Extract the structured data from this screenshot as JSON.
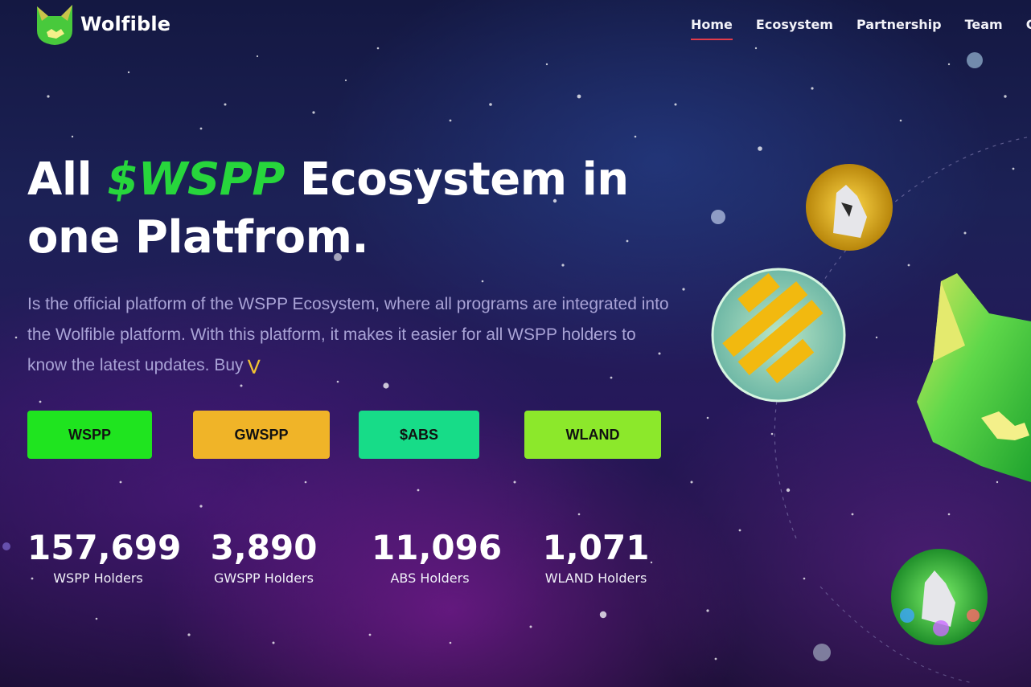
{
  "brand": {
    "name": "Wolfible"
  },
  "nav": {
    "items": [
      {
        "label": "Home",
        "active": true
      },
      {
        "label": "Ecosystem",
        "active": false
      },
      {
        "label": "Partnership",
        "active": false
      },
      {
        "label": "Team",
        "active": false
      },
      {
        "label": "Co",
        "active": false
      }
    ]
  },
  "hero": {
    "title_prefix": "All",
    "title_accent": "$WSPP",
    "title_line1_suffix": "Ecosystem in",
    "title_line2": "one Platfrom.",
    "description": "Is the official platform of the WSPP Ecosystem, where all programs are integrated into the Wolfible platform. With this platform, it makes it easier for all WSPP holders to know the latest updates. Buy",
    "buy_icon": "double-chevron-down-icon"
  },
  "buttons": [
    {
      "label": "WSPP",
      "color": "#1fe41f"
    },
    {
      "label": "GWSPP",
      "color": "#f0b428"
    },
    {
      "label": "$ABS",
      "color": "#17dc88"
    },
    {
      "label": "WLAND",
      "color": "#8ce82b"
    }
  ],
  "stats": [
    {
      "value": "157,699",
      "label": "WSPP Holders"
    },
    {
      "value": "3,890",
      "label": "GWSPP Holders"
    },
    {
      "value": "11,096",
      "label": "ABS Holders"
    },
    {
      "value": "1,071",
      "label": "WLAND Holders"
    }
  ],
  "colors": {
    "accent_green": "#27d63c",
    "nav_underline": "#e23b4a",
    "description_text": "#a9a3d6"
  }
}
